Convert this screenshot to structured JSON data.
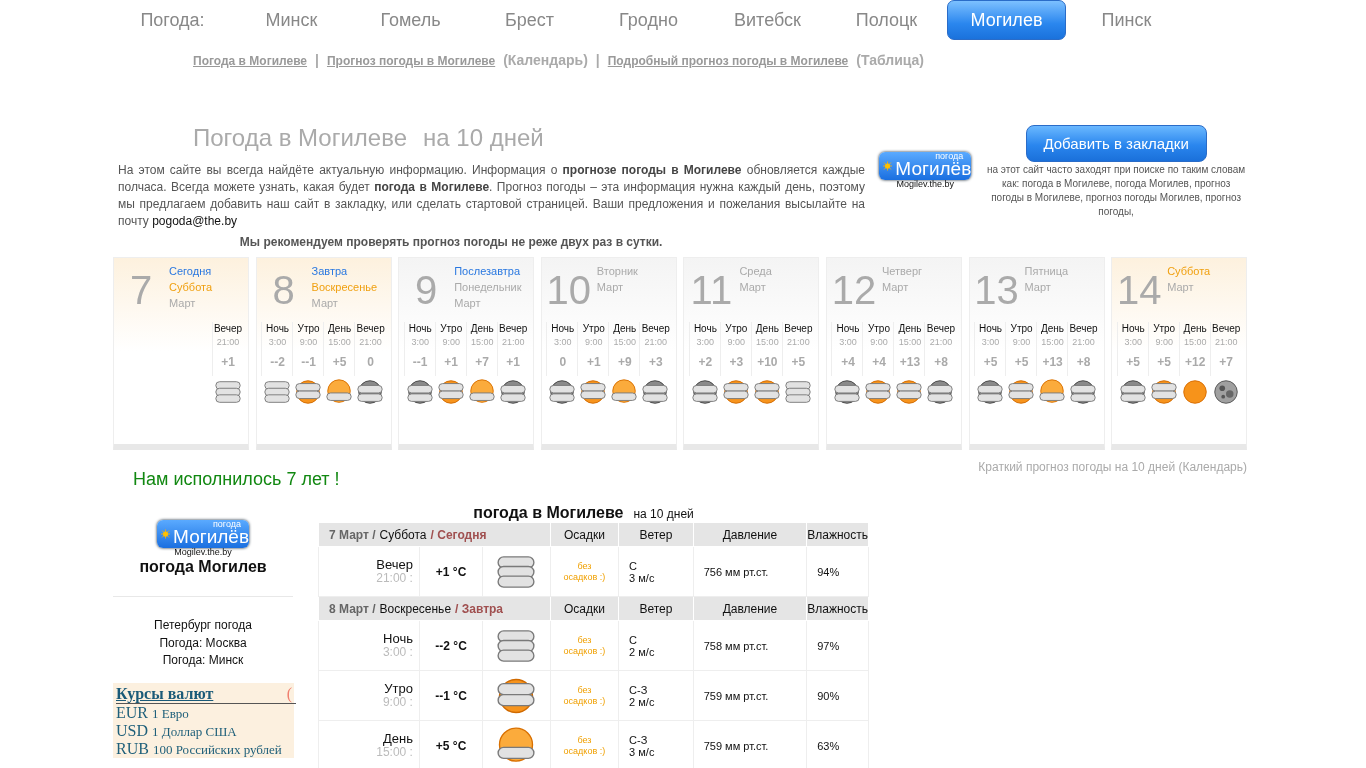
{
  "nav": {
    "label": "Погода:",
    "cities": [
      {
        "name": "Минск",
        "selected": false
      },
      {
        "name": "Гомель",
        "selected": false
      },
      {
        "name": "Брест",
        "selected": false
      },
      {
        "name": "Гродно",
        "selected": false
      },
      {
        "name": "Витебск",
        "selected": false
      },
      {
        "name": "Полоцк",
        "selected": false
      },
      {
        "name": "Могилев",
        "selected": true
      },
      {
        "name": "Пинск",
        "selected": false
      }
    ]
  },
  "sublinks": [
    {
      "kind": "link",
      "text": "Погода в Могилеве"
    },
    {
      "kind": "sep",
      "text": "|"
    },
    {
      "kind": "link",
      "text": "Прогноз погоды в Могилеве"
    },
    {
      "kind": "note",
      "text": "(Календарь)"
    },
    {
      "kind": "sep",
      "text": "|"
    },
    {
      "kind": "link",
      "text": "Подробный прогноз погоды в Могилеве"
    },
    {
      "kind": "note",
      "text": "(Таблица)"
    }
  ],
  "intro": {
    "title": "Погода в Могилеве",
    "subtitle": "на 10 дней",
    "text": "На этом сайте вы всегда найдёте актуальную информацию. Информация о **прогнозе погоды в Могилеве** обновляется каждые полчаса. Всегда можете узнать, какая будет **погода в Могилеве**. Прогноз погоды – эта информация нужна каждый день, поэтому мы предлагаем добавить наш сайт в закладку, или сделать стартовой страницей. Ваши предложения и пожелания высылайте на почту",
    "email": "pogoda@the.by",
    "recommend": "Мы рекомендуем проверять прогноз погоды не реже двух раз в сутки."
  },
  "promo": {
    "logo": {
      "caption": "погода",
      "title": "Могилёв",
      "url": "Mogilev.the.by"
    },
    "bookmark_button": "Добавить в закладки",
    "keywords": "на этот сайт часто заходят при поиске по таким словам как: погода в Могилеве, погода Могилев, прогноз погоды в Могилеве, прогноз погоды Могилев, прогноз погоды,"
  },
  "days": [
    {
      "day": "7",
      "weekend": true,
      "labels": [
        {
          "kind": "relative",
          "text": "Сегодня"
        },
        {
          "kind": "weekend",
          "text": "Суббота"
        },
        {
          "kind": "month",
          "text": "Март"
        }
      ],
      "periods": [
        {
          "name": "Вечер",
          "time": "21:00",
          "temp": "+1",
          "kind": "overcast"
        }
      ]
    },
    {
      "day": "8",
      "weekend": true,
      "labels": [
        {
          "kind": "relative",
          "text": "Завтра"
        },
        {
          "kind": "weekend",
          "text": "Воскресенье"
        },
        {
          "kind": "month",
          "text": "Март"
        }
      ],
      "periods": [
        {
          "name": "Ночь",
          "time": "3:00",
          "temp": "--2",
          "kind": "overcast"
        },
        {
          "name": "Утро",
          "time": "9:00",
          "temp": "--1",
          "kind": "cloud-sun"
        },
        {
          "name": "День",
          "time": "15:00",
          "temp": "+5",
          "kind": "sun-cloud"
        },
        {
          "name": "Вечер",
          "time": "21:00",
          "temp": "0",
          "kind": "moon-cloud"
        }
      ]
    },
    {
      "day": "9",
      "weekend": false,
      "labels": [
        {
          "kind": "relative",
          "text": "Послезавтра"
        },
        {
          "kind": "weekday",
          "text": "Понедельник"
        },
        {
          "kind": "month",
          "text": "Март"
        }
      ],
      "periods": [
        {
          "name": "Ночь",
          "time": "3:00",
          "temp": "--1",
          "kind": "moon-cloud"
        },
        {
          "name": "Утро",
          "time": "9:00",
          "temp": "+1",
          "kind": "cloud-sun"
        },
        {
          "name": "День",
          "time": "15:00",
          "temp": "+7",
          "kind": "sun-cloud"
        },
        {
          "name": "Вечер",
          "time": "21:00",
          "temp": "+1",
          "kind": "moon-cloud"
        }
      ]
    },
    {
      "day": "10",
      "weekend": false,
      "labels": [
        {
          "kind": "weekday",
          "text": "Вторник"
        },
        {
          "kind": "month",
          "text": "Март"
        }
      ],
      "periods": [
        {
          "name": "Ночь",
          "time": "3:00",
          "temp": "0",
          "kind": "moon-cloud"
        },
        {
          "name": "Утро",
          "time": "9:00",
          "temp": "+1",
          "kind": "cloud-sun"
        },
        {
          "name": "День",
          "time": "15:00",
          "temp": "+9",
          "kind": "sun-cloud"
        },
        {
          "name": "Вечер",
          "time": "21:00",
          "temp": "+3",
          "kind": "moon-cloud"
        }
      ]
    },
    {
      "day": "11",
      "weekend": false,
      "labels": [
        {
          "kind": "weekday",
          "text": "Среда"
        },
        {
          "kind": "month",
          "text": "Март"
        }
      ],
      "periods": [
        {
          "name": "Ночь",
          "time": "3:00",
          "temp": "+2",
          "kind": "moon-cloud"
        },
        {
          "name": "Утро",
          "time": "9:00",
          "temp": "+3",
          "kind": "cloud-sun"
        },
        {
          "name": "День",
          "time": "15:00",
          "temp": "+10",
          "kind": "cloud-sun"
        },
        {
          "name": "Вечер",
          "time": "21:00",
          "temp": "+5",
          "kind": "overcast"
        }
      ]
    },
    {
      "day": "12",
      "weekend": false,
      "labels": [
        {
          "kind": "weekday",
          "text": "Четверг"
        },
        {
          "kind": "month",
          "text": "Март"
        }
      ],
      "periods": [
        {
          "name": "Ночь",
          "time": "3:00",
          "temp": "+4",
          "kind": "moon-cloud"
        },
        {
          "name": "Утро",
          "time": "9:00",
          "temp": "+4",
          "kind": "cloud-sun"
        },
        {
          "name": "День",
          "time": "15:00",
          "temp": "+13",
          "kind": "cloud-sun"
        },
        {
          "name": "Вечер",
          "time": "21:00",
          "temp": "+8",
          "kind": "moon-cloud"
        }
      ]
    },
    {
      "day": "13",
      "weekend": false,
      "labels": [
        {
          "kind": "weekday",
          "text": "Пятница"
        },
        {
          "kind": "month",
          "text": "Март"
        }
      ],
      "periods": [
        {
          "name": "Ночь",
          "time": "3:00",
          "temp": "+5",
          "kind": "moon-cloud"
        },
        {
          "name": "Утро",
          "time": "9:00",
          "temp": "+5",
          "kind": "cloud-sun"
        },
        {
          "name": "День",
          "time": "15:00",
          "temp": "+13",
          "kind": "sun-cloud"
        },
        {
          "name": "Вечер",
          "time": "21:00",
          "temp": "+8",
          "kind": "moon-cloud"
        }
      ]
    },
    {
      "day": "14",
      "weekend": true,
      "labels": [
        {
          "kind": "weekend",
          "text": "Суббота"
        },
        {
          "kind": "month",
          "text": "Март"
        }
      ],
      "periods": [
        {
          "name": "Ночь",
          "time": "3:00",
          "temp": "+5",
          "kind": "moon-cloud"
        },
        {
          "name": "Утро",
          "time": "9:00",
          "temp": "+5",
          "kind": "cloud-sun"
        },
        {
          "name": "День",
          "time": "15:00",
          "temp": "+12",
          "kind": "sun"
        },
        {
          "name": "Вечер",
          "time": "21:00",
          "temp": "+7",
          "kind": "moon"
        }
      ]
    }
  ],
  "anniversary": "Нам исполнилось 7 лет !",
  "calendar_link": "Краткий прогноз погоды на 10 дней (Календарь)",
  "sidebar": {
    "logo": {
      "caption": "погода",
      "title": "Могилёв",
      "url": "Mogilev.the.by"
    },
    "title": "погода Могилев",
    "links": [
      "Петербург погода",
      "Погода: Москва",
      "Погода: Минск"
    ],
    "currency": {
      "title": "Курсы валют",
      "cut_mark": "(",
      "rates": [
        {
          "code": "EUR",
          "name": "1 Евро"
        },
        {
          "code": "USD",
          "name": "1 Доллар США"
        },
        {
          "code": "RUB",
          "name": "100 Российских рублей"
        }
      ]
    }
  },
  "table": {
    "title": "погода в Могилеве",
    "subtitle": "на 10 дней",
    "sections": [
      {
        "date": "7 Март /",
        "weekday": "Суббота",
        "relative": "/ Сегодня",
        "columns": [
          "Осадки",
          "Ветер",
          "Давление",
          "Влажность"
        ],
        "rows": [
          {
            "period": "Вечер",
            "time": "21:00 :",
            "temp": "+1 °C",
            "kind": "overcast",
            "precip": "без осадков :)",
            "wind_dir": "С",
            "wind_speed": "3 м/с",
            "pressure": "756 мм рт.ст.",
            "humidity": "94%"
          }
        ]
      },
      {
        "date": "8 Март /",
        "weekday": "Воскресенье",
        "relative": "/ Завтра",
        "columns": [
          "Осадки",
          "Ветер",
          "Давление",
          "Влажность"
        ],
        "rows": [
          {
            "period": "Ночь",
            "time": "3:00 :",
            "temp": "--2 °C",
            "kind": "overcast",
            "precip": "без осадков :)",
            "wind_dir": "С",
            "wind_speed": "2 м/с",
            "pressure": "758 мм рт.ст.",
            "humidity": "97%"
          },
          {
            "period": "Утро",
            "time": "9:00 :",
            "temp": "--1 °C",
            "kind": "cloud-sun",
            "precip": "без осадков :)",
            "wind_dir": "С-З",
            "wind_speed": "2 м/с",
            "pressure": "759 мм рт.ст.",
            "humidity": "90%"
          },
          {
            "period": "День",
            "time": "15:00 :",
            "temp": "+5 °C",
            "kind": "sun-cloud",
            "precip": "без осадков :)",
            "wind_dir": "С-З",
            "wind_speed": "3 м/с",
            "pressure": "759 мм рт.ст.",
            "humidity": "63%"
          }
        ]
      }
    ]
  }
}
